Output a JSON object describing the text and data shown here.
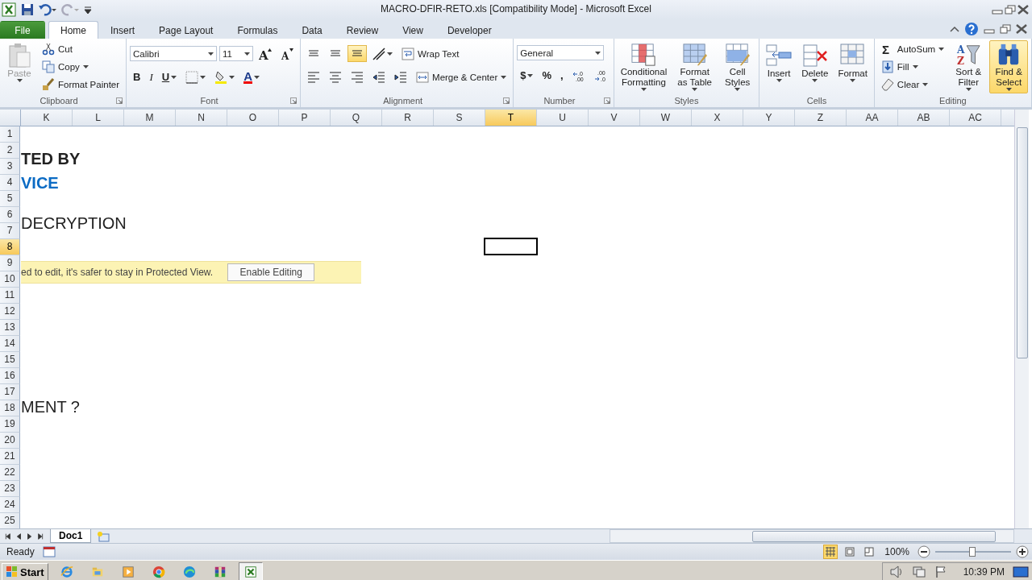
{
  "window": {
    "title": "MACRO-DFIR-RETO.xls  [Compatibility Mode]  -  Microsoft Excel"
  },
  "ribbon_tabs": [
    {
      "label": "File",
      "kind": "file",
      "selected": false
    },
    {
      "label": "Home",
      "kind": "tab",
      "selected": true
    },
    {
      "label": "Insert",
      "kind": "tab",
      "selected": false
    },
    {
      "label": "Page Layout",
      "kind": "tab",
      "selected": false
    },
    {
      "label": "Formulas",
      "kind": "tab",
      "selected": false
    },
    {
      "label": "Data",
      "kind": "tab",
      "selected": false
    },
    {
      "label": "Review",
      "kind": "tab",
      "selected": false
    },
    {
      "label": "View",
      "kind": "tab",
      "selected": false
    },
    {
      "label": "Developer",
      "kind": "tab",
      "selected": false
    }
  ],
  "ribbon_groups": [
    {
      "label": "Clipboard",
      "launcher": true,
      "stacks": [
        {
          "kind": "large",
          "label": "Paste",
          "disabled": true,
          "dropdown": true
        },
        {
          "kind": "column",
          "items": [
            {
              "kind": "small",
              "label": "Cut",
              "dropdown": false
            },
            {
              "kind": "small",
              "label": "Copy",
              "dropdown": true
            },
            {
              "kind": "small",
              "label": "Format Painter",
              "dropdown": false
            }
          ]
        }
      ]
    },
    {
      "label": "Font",
      "launcher": true,
      "stacks": [
        {
          "kind": "rows",
          "items": [
            [
              {
                "kind": "field",
                "value": "Calibri"
              },
              {
                "kind": "size_field",
                "value": "11"
              },
              {
                "kind": "icon",
                "symbols": [
                  "A"
                ]
              },
              {
                "kind": "icon",
                "symbols": [
                  "A"
                ]
              }
            ],
            [
              {
                "kind": "text",
                "label": "B"
              },
              {
                "kind": "text",
                "label": "I"
              },
              {
                "kind": "text",
                "label": "U",
                "dropdown": true
              },
              {
                "kind": "icon",
                "dropdown": true
              },
              {
                "kind": "icon",
                "dropdown": true
              },
              {
                "kind": "text",
                "label": "A",
                "dropdown": true
              }
            ]
          ]
        }
      ]
    },
    {
      "label": "Alignment",
      "launcher": true,
      "stacks": [
        {
          "kind": "rows",
          "items": [
            [
              {
                "kind": "icon",
                "selected": false
              },
              {
                "kind": "icon",
                "selected": false
              },
              {
                "kind": "icon",
                "selected": true
              },
              {
                "kind": "icon",
                "dropdown": true
              },
              {
                "kind": "small",
                "label": "Wrap Text",
                "dropdown": false
              }
            ],
            [
              {
                "kind": "icon",
                "selected": false
              },
              {
                "kind": "icon",
                "selected": false
              },
              {
                "kind": "icon",
                "selected": false
              },
              {
                "kind": "icon"
              },
              {
                "kind": "icon"
              },
              {
                "kind": "small",
                "label": "Merge & Center",
                "dropdown": true
              }
            ]
          ]
        }
      ]
    },
    {
      "label": "Number",
      "launcher": true,
      "stacks": [
        {
          "kind": "rows",
          "items": [
            [
              {
                "kind": "field",
                "value": "General"
              }
            ],
            [
              {
                "kind": "text",
                "label": "$",
                "dropdown": true
              },
              {
                "kind": "text",
                "label": "%"
              },
              {
                "kind": "text",
                "label": ","
              },
              {
                "kind": "icon",
                "symbols": [
                  ".0",
                  ".00"
                ]
              },
              {
                "kind": "icon",
                "symbols": [
                  ".00",
                  ".0"
                ]
              }
            ]
          ]
        }
      ]
    },
    {
      "label": "Styles",
      "launcher": false,
      "stacks": [
        {
          "kind": "large",
          "label": "Conditional Formatting",
          "dropdown": true
        },
        {
          "kind": "large",
          "label": "Format as Table",
          "dropdown": true
        },
        {
          "kind": "large",
          "label": "Cell Styles",
          "dropdown": true
        }
      ]
    },
    {
      "label": "Cells",
      "launcher": false,
      "stacks": [
        {
          "kind": "large",
          "label": "Insert",
          "dropdown": true
        },
        {
          "kind": "large",
          "label": "Delete",
          "dropdown": true
        },
        {
          "kind": "large",
          "label": "Format",
          "dropdown": true
        }
      ]
    },
    {
      "label": "Editing",
      "launcher": false,
      "stacks": [
        {
          "kind": "column",
          "items": [
            {
              "kind": "small",
              "label": "AutoSum",
              "dropdown": true,
              "symbols": [
                "Σ"
              ]
            },
            {
              "kind": "small",
              "label": "Fill",
              "dropdown": true
            },
            {
              "kind": "small",
              "label": "Clear",
              "dropdown": true
            }
          ]
        },
        {
          "kind": "large",
          "label": "Sort & Filter",
          "dropdown": true,
          "symbols": [
            "A",
            "Z"
          ]
        },
        {
          "kind": "large",
          "label": "Find & Select",
          "dropdown": true,
          "selected": true
        }
      ]
    }
  ],
  "sheet": {
    "columns": [
      {
        "label": "K",
        "selected": false
      },
      {
        "label": "L",
        "selected": false
      },
      {
        "label": "M",
        "selected": false
      },
      {
        "label": "N",
        "selected": false
      },
      {
        "label": "O",
        "selected": false
      },
      {
        "label": "P",
        "selected": false
      },
      {
        "label": "Q",
        "selected": false
      },
      {
        "label": "R",
        "selected": false
      },
      {
        "label": "S",
        "selected": false
      },
      {
        "label": "T",
        "selected": true
      },
      {
        "label": "U",
        "selected": false
      },
      {
        "label": "V",
        "selected": false
      },
      {
        "label": "W",
        "selected": false
      },
      {
        "label": "X",
        "selected": false
      },
      {
        "label": "Y",
        "selected": false
      },
      {
        "label": "Z",
        "selected": false
      },
      {
        "label": "AA",
        "selected": false
      },
      {
        "label": "AB",
        "selected": false
      },
      {
        "label": "AC",
        "selected": false
      }
    ],
    "rows": [
      {
        "number": "1",
        "selected": false
      },
      {
        "number": "2",
        "selected": false,
        "text": "TED BY",
        "kind": "bold"
      },
      {
        "number": "3",
        "selected": false
      },
      {
        "number": "4",
        "selected": false,
        "text": "VICE",
        "kind": "link"
      },
      {
        "number": "5",
        "selected": false
      },
      {
        "number": "6",
        "selected": false,
        "text": "DECRYPTION",
        "kind": "plain"
      },
      {
        "number": "7",
        "selected": false
      },
      {
        "number": "8",
        "selected": true
      },
      {
        "number": "9",
        "selected": false
      },
      {
        "number": "10",
        "selected": false
      },
      {
        "number": "11",
        "selected": false
      },
      {
        "number": "12",
        "selected": false
      },
      {
        "number": "13",
        "selected": false
      },
      {
        "number": "14",
        "selected": false
      },
      {
        "number": "15",
        "selected": false
      },
      {
        "number": "16",
        "selected": false
      },
      {
        "number": "17",
        "selected": false
      },
      {
        "number": "18",
        "selected": false,
        "text": "MENT ?",
        "kind": "low"
      },
      {
        "number": "19",
        "selected": false
      },
      {
        "number": "20",
        "selected": false
      },
      {
        "number": "21",
        "selected": false
      },
      {
        "number": "22",
        "selected": false
      },
      {
        "number": "23",
        "selected": false
      },
      {
        "number": "24",
        "selected": false
      },
      {
        "number": "25",
        "selected": false
      }
    ]
  },
  "protected_view": {
    "message": "ed to edit, it's safer to stay in Protected View.",
    "button": "Enable Editing"
  },
  "sheet_tabs": [
    {
      "label": "Doc1",
      "selected": true
    }
  ],
  "status_bar": {
    "mode": "Ready",
    "zoom": "100%",
    "zoom_slider": {
      "level": 0.5
    }
  },
  "taskbar": {
    "start": "Start",
    "apps": [
      {
        "kind": "ie",
        "selected": false
      },
      {
        "kind": "folder",
        "selected": false
      },
      {
        "kind": "media",
        "selected": false
      },
      {
        "kind": "chrome",
        "selected": false
      },
      {
        "kind": "edge",
        "selected": false
      },
      {
        "kind": "winrar",
        "selected": false
      },
      {
        "kind": "excel",
        "selected": true
      }
    ],
    "clock": "10:39 PM"
  }
}
